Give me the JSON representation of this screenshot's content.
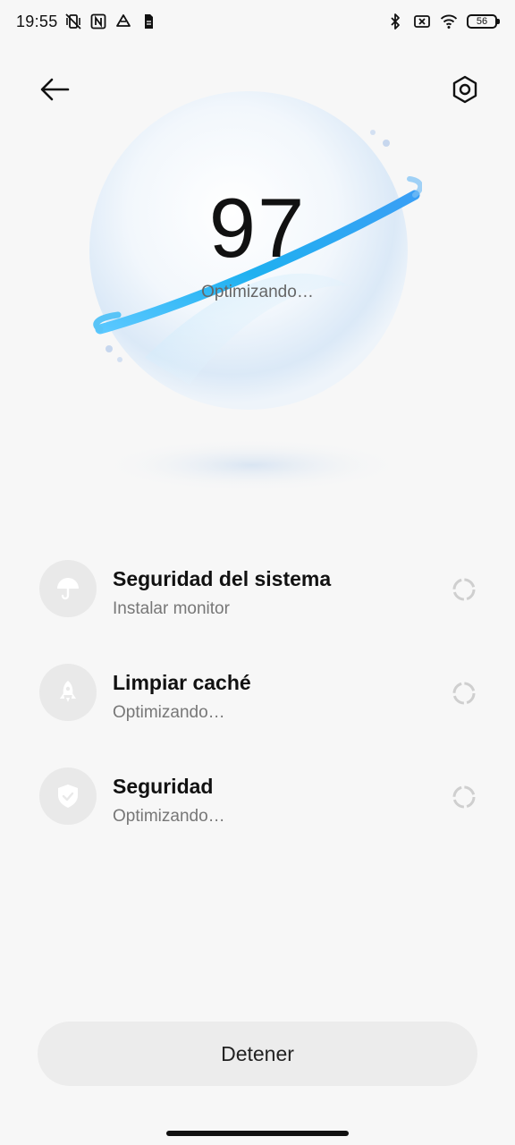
{
  "status_bar": {
    "time": "19:55",
    "battery": "56",
    "left_icons": [
      "vibrate-off-icon",
      "nfc-icon",
      "drive-icon",
      "sim-icon"
    ],
    "right_icons": [
      "bluetooth-icon",
      "no-sim-icon",
      "wifi-icon",
      "battery-icon"
    ]
  },
  "header": {
    "back_icon": "arrow-left-icon",
    "settings_icon": "hexagon-settings-icon"
  },
  "hero": {
    "score": "97",
    "status": "Optimizando…",
    "accent_color": "#2fb8f0"
  },
  "tasks": [
    {
      "title": "Seguridad del sistema",
      "subtitle": "Instalar monitor",
      "icon": "umbrella-icon"
    },
    {
      "title": "Limpiar caché",
      "subtitle": "Optimizando…",
      "icon": "rocket-icon"
    },
    {
      "title": "Seguridad",
      "subtitle": "Optimizando…",
      "icon": "shield-check-icon"
    }
  ],
  "footer": {
    "stop_label": "Detener"
  }
}
